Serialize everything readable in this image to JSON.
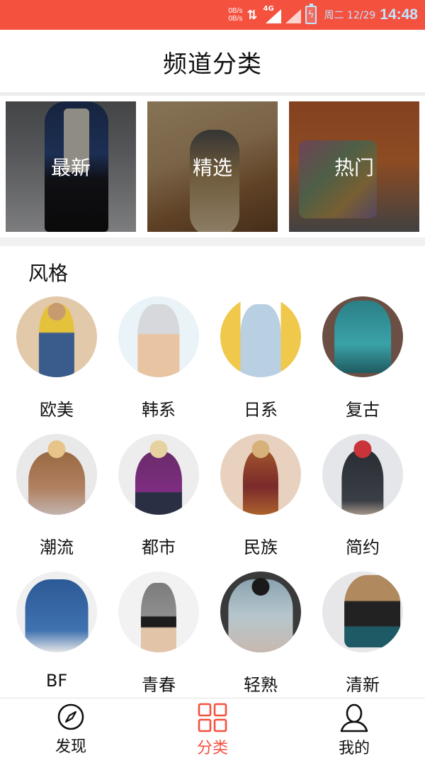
{
  "status_bar": {
    "net_up": "0B/s",
    "net_down": "0B/s",
    "network_type": "4G",
    "date": "周二 12/29",
    "time": "14:48",
    "bg_color": "#f4513f"
  },
  "header": {
    "title": "频道分类"
  },
  "featured": [
    {
      "label": "最新"
    },
    {
      "label": "精选"
    },
    {
      "label": "热门"
    }
  ],
  "style_section": {
    "title": "风格",
    "items": [
      {
        "label": "欧美"
      },
      {
        "label": "韩系"
      },
      {
        "label": "日系"
      },
      {
        "label": "复古"
      },
      {
        "label": "潮流"
      },
      {
        "label": "都市"
      },
      {
        "label": "民族"
      },
      {
        "label": "简约"
      },
      {
        "label": "BF"
      },
      {
        "label": "青春"
      },
      {
        "label": "轻熟"
      },
      {
        "label": "清新"
      }
    ]
  },
  "bottom_nav": {
    "items": [
      {
        "label": "发现",
        "icon": "compass-icon"
      },
      {
        "label": "分类",
        "icon": "grid-icon",
        "active": true
      },
      {
        "label": "我的",
        "icon": "user-icon"
      }
    ],
    "active_color": "#f4513f"
  }
}
